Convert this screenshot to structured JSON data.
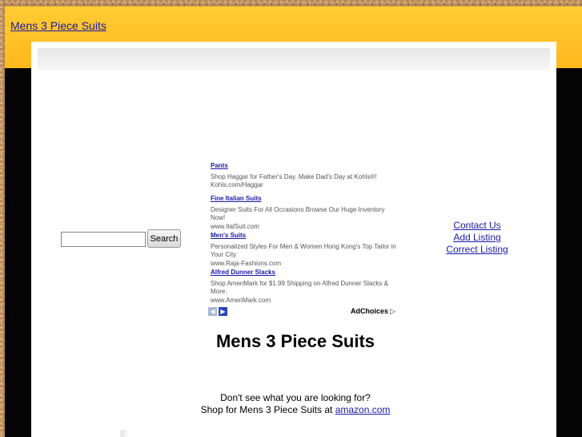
{
  "header": {
    "site_title": "Mens 3 Piece Suits"
  },
  "search": {
    "value": "",
    "placeholder": "",
    "button_label": "Search"
  },
  "ads": {
    "items": [
      {
        "title": "Pants",
        "description": "Shop Haggar for Father's Day. Make Dad's Day at Kohls®!",
        "url": "Kohls.com/Haggar"
      },
      {
        "title": "Fine Italian Suits",
        "description": "Designer Suits For All Occasions Browse Our Huge Inventory Now!",
        "url": "www.ItalSuit.com"
      },
      {
        "title": "Men's Suits",
        "description": "Personalized Styles For Men & Women Hong Kong's Top Tailor in Your City",
        "url": "www.Raja-Fashions.com"
      },
      {
        "title": "Alfred Dunner Slacks",
        "description": "Shop AmeriMark for $1.99 Shipping on Alfred Dunner Slacks & More.",
        "url": "www.AmeriMark.com"
      }
    ],
    "prev_icon": "◀",
    "next_icon": "▶",
    "adchoices_label": "AdChoices",
    "adchoices_icon": "▷"
  },
  "links": {
    "contact": "Contact Us",
    "add_listing": "Add Listing",
    "correct_listing": "Correct Listing"
  },
  "main": {
    "heading": "Mens 3 Piece Suits",
    "cta_question": "Don't see what you are looking for?",
    "cta_prefix": "Shop for Mens 3 Piece Suits at",
    "amazon_link": "amazon.com"
  },
  "colors": {
    "header_bar": "#ffc22a",
    "dark_band": "#050505",
    "link": "#1a1aa6"
  }
}
